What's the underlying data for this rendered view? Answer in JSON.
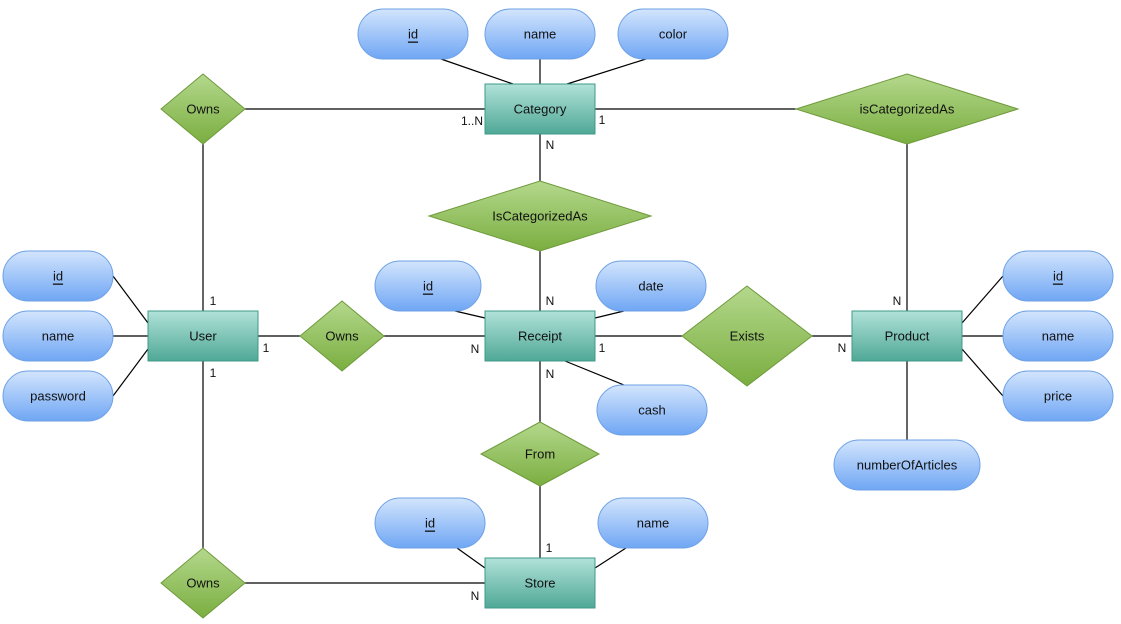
{
  "colors": {
    "entity": "#7fc8b8",
    "attribute": "#9fc4fa",
    "relationship": "#98c466",
    "line": "#000000"
  },
  "entities": {
    "category": "Category",
    "user": "User",
    "receipt": "Receipt",
    "product": "Product",
    "store": "Store"
  },
  "attributes": {
    "category": {
      "id": "id",
      "name": "name",
      "color": "color"
    },
    "user": {
      "id": "id",
      "name": "name",
      "password": "password"
    },
    "receipt": {
      "id": "id",
      "date": "date",
      "cash": "cash"
    },
    "product": {
      "id": "id",
      "name": "name",
      "price": "price",
      "numberOfArticles": "numberOfArticles"
    },
    "store": {
      "id": "id",
      "name": "name"
    }
  },
  "relationships": {
    "owns_category": "Owns",
    "product_categorized": "isCategorizedAs",
    "receipt_categorized": "IsCategorizedAs",
    "owns_receipt": "Owns",
    "exists": "Exists",
    "from": "From",
    "owns_store": "Owns"
  },
  "cardinalities": {
    "category_user": "1..N",
    "category_product": "1",
    "category_receipt": "N",
    "user_top": "1",
    "user_right": "1",
    "user_bottom": "1",
    "receipt_left": "N",
    "receipt_top": "N",
    "receipt_right": "1",
    "receipt_bottom": "N",
    "product_left": "N",
    "product_top": "N",
    "store_top": "1",
    "store_left": "N"
  }
}
